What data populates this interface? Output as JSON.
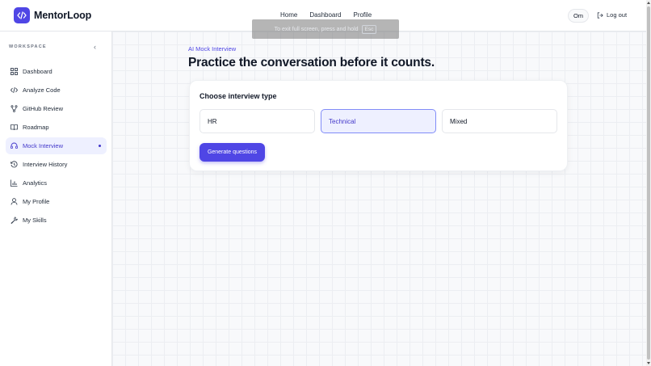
{
  "brand": {
    "name": "MentorLoop",
    "logo_glyph": "</>"
  },
  "topnav": {
    "home": "Home",
    "dashboard": "Dashboard",
    "profile": "Profile"
  },
  "user": {
    "initials": "Om",
    "logout_label": "Log out"
  },
  "fullscreen_toast": {
    "text": "To exit full screen, press and hold",
    "key": "Esc"
  },
  "sidebar": {
    "section_label": "WORKSPACE",
    "items": [
      {
        "label": "Dashboard",
        "icon": "grid-icon"
      },
      {
        "label": "Analyze Code",
        "icon": "code-icon"
      },
      {
        "label": "GitHub Review",
        "icon": "git-branch-icon"
      },
      {
        "label": "Roadmap",
        "icon": "book-icon"
      },
      {
        "label": "Mock Interview",
        "icon": "headset-icon",
        "active": true
      },
      {
        "label": "Interview History",
        "icon": "history-icon"
      },
      {
        "label": "Analytics",
        "icon": "bar-chart-icon"
      },
      {
        "label": "My Profile",
        "icon": "user-icon"
      },
      {
        "label": "My Skills",
        "icon": "wrench-icon"
      }
    ]
  },
  "main": {
    "eyebrow": "AI Mock Interview",
    "headline": "Practice the conversation before it counts.",
    "card": {
      "title": "Choose interview type",
      "options": [
        "HR",
        "Technical",
        "Mixed"
      ],
      "selected": "Technical",
      "generate_label": "Generate questions"
    }
  },
  "colors": {
    "accent": "#4f46e5",
    "active_bg": "#eef0ff",
    "text": "#111827"
  }
}
